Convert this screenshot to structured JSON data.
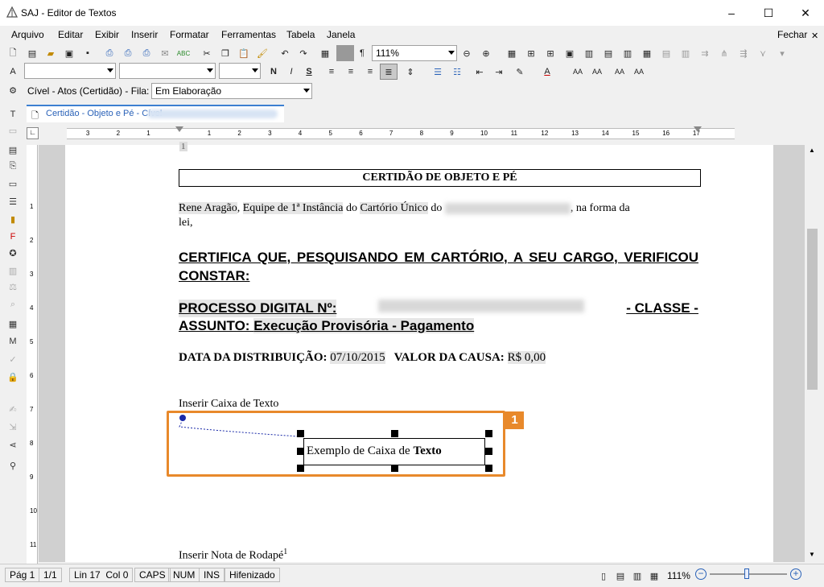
{
  "window": {
    "title": "SAJ - Editor de Textos",
    "minimize": "–",
    "maximize": "☐",
    "close": "✕"
  },
  "menu": {
    "items": [
      "Arquivo",
      "Editar",
      "Exibir",
      "Inserir",
      "Formatar",
      "Ferramentas",
      "Tabela",
      "Janela"
    ],
    "close_label": "Fechar"
  },
  "toolbar": {
    "zoom": "111%",
    "pilcrow": "¶"
  },
  "format": {
    "bold": "N",
    "italic": "I",
    "underline": "S"
  },
  "queue": {
    "label": "Cível - Atos (Certidão) - Fila:",
    "value": "Em Elaboração"
  },
  "tab": {
    "label": "Certidão - Objeto e Pé - Cível"
  },
  "ruler": {
    "marks": [
      "3",
      "2",
      "1",
      "1",
      "2",
      "3",
      "4",
      "5",
      "6",
      "7",
      "8",
      "9",
      "10",
      "11",
      "12",
      "13",
      "14",
      "15",
      "16",
      "17"
    ],
    "page_number": "1"
  },
  "document": {
    "title": "CERTIDÃO DE OBJETO E PÉ",
    "p1": {
      "name": "Rene Aragão",
      "role": "Equipe de 1ª Instância",
      "mid": "do",
      "place": "Cartório Único",
      "mid2": "do",
      "end": ", na forma da",
      "end2": "lei,"
    },
    "certifica": "CERTIFICA QUE, PESQUISANDO EM CARTÓRIO, A SEU CARGO, VERIFICOU CONSTAR:",
    "processo": {
      "label": "PROCESSO DIGITAL Nº:",
      "sep": "- CLASSE -",
      "assunto_label": "ASSUNTO:",
      "assunto": "Execução Provisória - Pagamento"
    },
    "dist": {
      "label": "DATA DA DISTRIBUIÇÃO:",
      "date": "07/10/2015",
      "valor_label": "VALOR DA CAUSA:",
      "valor": "R$ 0,00"
    },
    "textbox_heading": "Inserir Caixa de Texto",
    "textbox": {
      "normal": "Exemplo de Caixa de ",
      "bold": "Texto"
    },
    "callout_number": "1",
    "footnote_heading": "Inserir Nota de Rodapé",
    "footnote_mark": "1"
  },
  "status": {
    "page": "Pág 1",
    "pages": "1/1",
    "position": "Lin 17  Col 0",
    "caps": "CAPS",
    "num": "NUM",
    "ins": "INS",
    "hyphen": "Hifenizado",
    "zoom": "111%"
  },
  "accent_color": "#e8892b"
}
